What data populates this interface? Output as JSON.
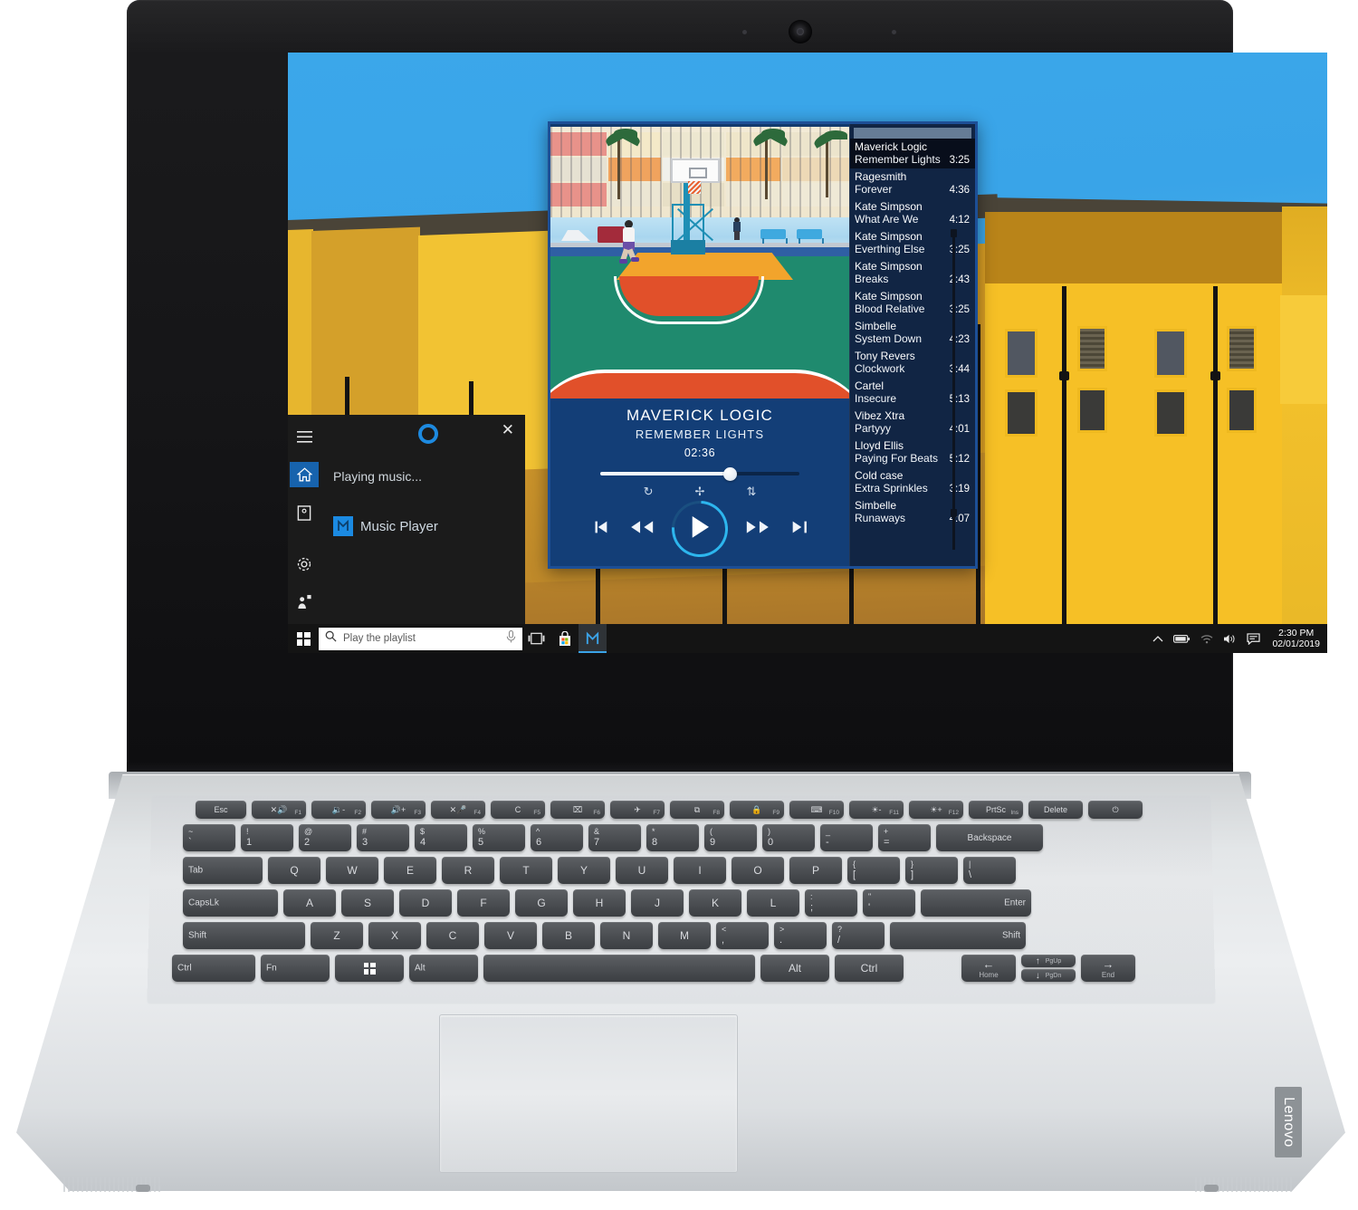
{
  "device": {
    "brand": "Lenovo",
    "webcam_label": "webcam"
  },
  "desktop": {
    "wallpaper_description": "yellow modern building facade against blue sky"
  },
  "player": {
    "window_title": "Music Player",
    "album_art_description": "basketball court with colorful apartment buildings",
    "now_playing": {
      "artist": "MAVERICK LOGIC",
      "track": "REMEMBER LIGHTS",
      "elapsed": "02:36",
      "progress_percent": 65
    },
    "controls": {
      "repeat_one": "repeat-one",
      "shuffle": "shuffle",
      "repeat_all": "repeat-all",
      "previous": "skip-previous",
      "rewind": "rewind",
      "play": "play",
      "fast_forward": "fast-forward",
      "next": "skip-next"
    },
    "playlist": [
      {
        "artist": "Maverick Logic",
        "track": "Remember Lights",
        "duration": "3:25",
        "current": true
      },
      {
        "artist": "Ragesmith",
        "track": "Forever",
        "duration": "4:36",
        "current": false
      },
      {
        "artist": "Kate Simpson",
        "track": "What Are We",
        "duration": "4:12",
        "current": false
      },
      {
        "artist": "Kate Simpson",
        "track": "Everthing Else",
        "duration": "3:25",
        "current": false
      },
      {
        "artist": "Kate Simpson",
        "track": "Breaks",
        "duration": "2:43",
        "current": false
      },
      {
        "artist": "Kate Simpson",
        "track": "Blood Relative",
        "duration": "3:25",
        "current": false
      },
      {
        "artist": "Simbelle",
        "track": "System Down",
        "duration": "4:23",
        "current": false
      },
      {
        "artist": "Tony Revers",
        "track": "Clockwork",
        "duration": "3:44",
        "current": false
      },
      {
        "artist": "Cartel",
        "track": "Insecure",
        "duration": "5:13",
        "current": false
      },
      {
        "artist": "Vibez Xtra",
        "track": "Partyyy",
        "duration": "4:01",
        "current": false
      },
      {
        "artist": "Lloyd  Ellis",
        "track": "Paying For Beats",
        "duration": "5:12",
        "current": false
      },
      {
        "artist": "Cold case",
        "track": "Extra Sprinkles",
        "duration": "3:19",
        "current": false
      },
      {
        "artist": "Simbelle",
        "track": "Runaways",
        "duration": "4:07",
        "current": false
      }
    ]
  },
  "cortana": {
    "hamburger_icon": "hamburger-icon",
    "home_icon": "home-icon",
    "notebook_icon": "notebook-icon",
    "settings_icon": "gear-icon",
    "feedback_icon": "feedback-icon",
    "close_icon": "close-icon",
    "ring_icon": "cortana-ring-icon",
    "status_text": "Playing music...",
    "app_result": "Music Player"
  },
  "taskbar": {
    "start_label": "Start",
    "search_placeholder": "Play the playlist",
    "search_icon": "search-icon",
    "mic_icon": "microphone-icon",
    "task_view_icon": "task-view-icon",
    "store_icon": "microsoft-store-icon",
    "music_player_icon": "music-player-icon",
    "tray": {
      "chevron_icon": "chevron-up-icon",
      "battery_icon": "battery-icon",
      "wifi_icon": "wifi-icon",
      "volume_icon": "volume-icon",
      "action_center_icon": "action-center-icon",
      "time": "2:30 PM",
      "date": "02/01/2019"
    }
  },
  "keyboard": {
    "fn_row": [
      {
        "label": "Esc",
        "sub": ""
      },
      {
        "label": "✕🔊",
        "sub": "F1"
      },
      {
        "label": "🔉-",
        "sub": "F2"
      },
      {
        "label": "🔊+",
        "sub": "F3"
      },
      {
        "label": "✕🎤",
        "sub": "F4"
      },
      {
        "label": "C",
        "sub": "F5"
      },
      {
        "label": "⌧",
        "sub": "F6"
      },
      {
        "label": "✈",
        "sub": "F7"
      },
      {
        "label": "⧉",
        "sub": "F8"
      },
      {
        "label": "🔒",
        "sub": "F9"
      },
      {
        "label": "⌨",
        "sub": "F10"
      },
      {
        "label": "☀-",
        "sub": "F11"
      },
      {
        "label": "☀+",
        "sub": "F12"
      },
      {
        "label": "PrtSc",
        "sub": "Ins"
      },
      {
        "label": "Delete",
        "sub": ""
      },
      {
        "label": "⏻",
        "sub": ""
      }
    ],
    "num_row": [
      {
        "top": "~",
        "bot": "`"
      },
      {
        "top": "!",
        "bot": "1"
      },
      {
        "top": "@",
        "bot": "2"
      },
      {
        "top": "#",
        "bot": "3"
      },
      {
        "top": "$",
        "bot": "4"
      },
      {
        "top": "%",
        "bot": "5"
      },
      {
        "top": "^",
        "bot": "6"
      },
      {
        "top": "&",
        "bot": "7"
      },
      {
        "top": "*",
        "bot": "8"
      },
      {
        "top": "(",
        "bot": "9"
      },
      {
        "top": ")",
        "bot": "0"
      },
      {
        "top": "_",
        "bot": "-"
      },
      {
        "top": "+",
        "bot": "="
      }
    ],
    "backspace_label": "Backspace",
    "tab_label": "Tab",
    "qwerty_row": [
      "Q",
      "W",
      "E",
      "R",
      "T",
      "Y",
      "U",
      "I",
      "O",
      "P"
    ],
    "bracket_keys": [
      {
        "top": "{",
        "bot": "["
      },
      {
        "top": "}",
        "bot": "]"
      },
      {
        "top": "|",
        "bot": "\\"
      }
    ],
    "caps_label": "CapsLk",
    "asdf_row": [
      "A",
      "S",
      "D",
      "F",
      "G",
      "H",
      "J",
      "K",
      "L"
    ],
    "semicolon_keys": [
      {
        "top": ":",
        "bot": ";"
      },
      {
        "top": "\"",
        "bot": "'"
      }
    ],
    "enter_label": "Enter",
    "shift_label": "Shift",
    "zxcv_row": [
      "Z",
      "X",
      "C",
      "V",
      "B",
      "N",
      "M"
    ],
    "punct_keys": [
      {
        "top": "<",
        "bot": ","
      },
      {
        "top": ">",
        "bot": "."
      },
      {
        "top": "?",
        "bot": "/"
      }
    ],
    "shift_right_label": "Shift",
    "ctrl_label": "Ctrl",
    "fn_label": "Fn",
    "win_label": "Windows",
    "alt_label": "Alt",
    "space_label": "",
    "alt_right_label": "Alt",
    "ctrl_right_label": "Ctrl",
    "arrow_left": {
      "glyph": "←",
      "sub": "Home"
    },
    "arrow_up": {
      "glyph": "↑",
      "sub": "PgUp"
    },
    "arrow_down": {
      "glyph": "↓",
      "sub": "PgDn"
    },
    "arrow_right": {
      "glyph": "→",
      "sub": "End"
    }
  }
}
